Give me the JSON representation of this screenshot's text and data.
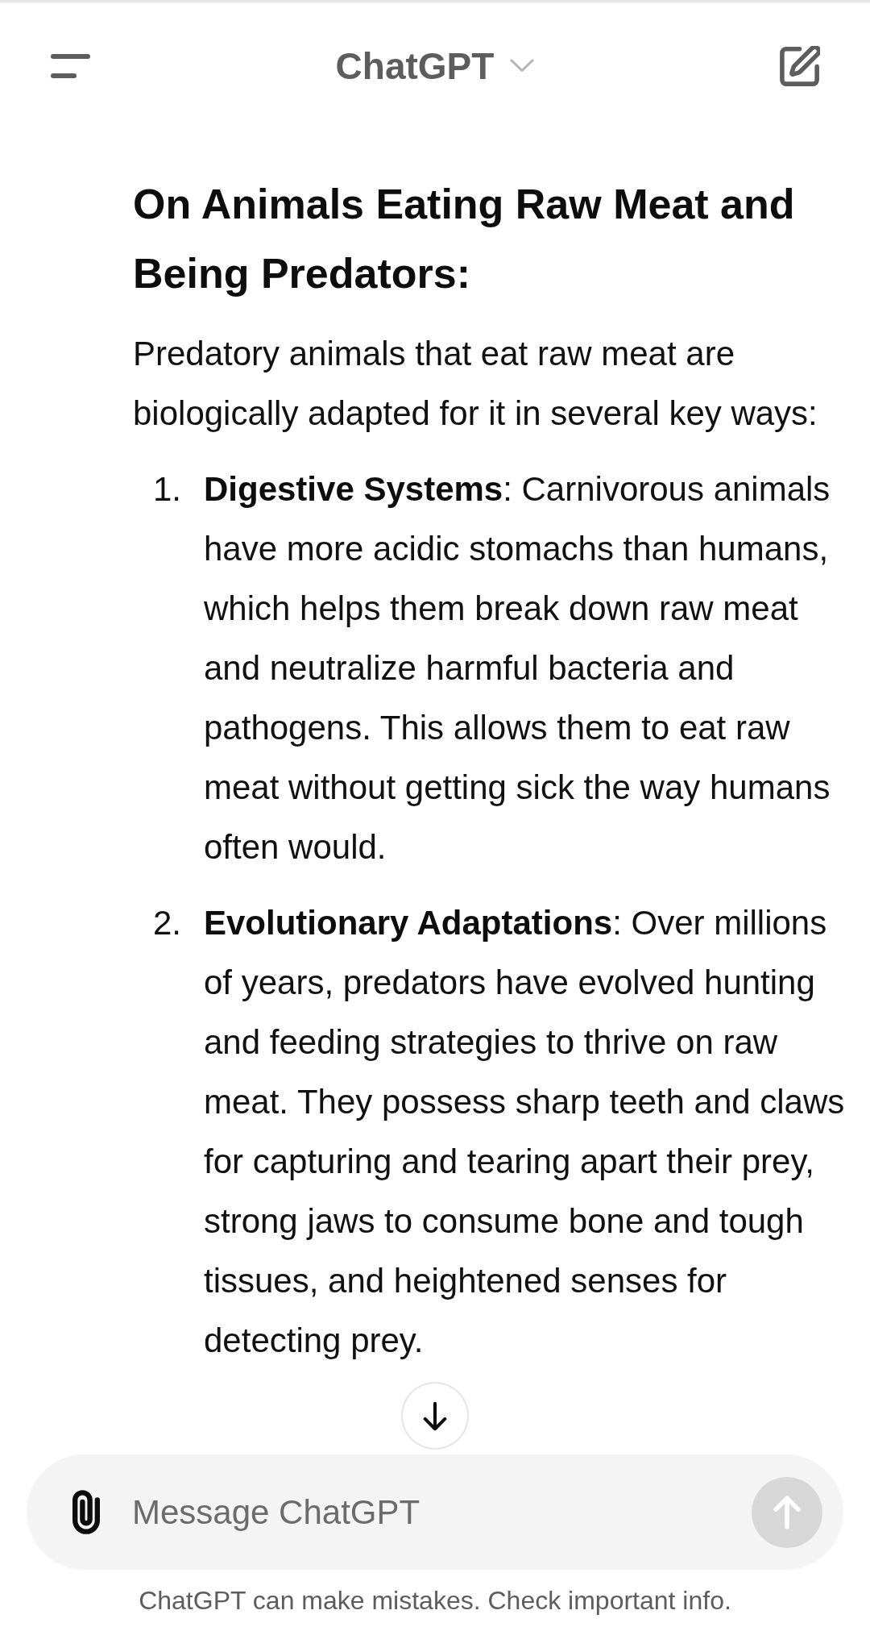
{
  "header": {
    "title": "ChatGPT"
  },
  "message": {
    "heading": "On Animals Eating Raw Meat and Being Predators:",
    "intro": "Predatory animals that eat raw meat are biologically adapted for it in several key ways:",
    "points": [
      {
        "number": "1.",
        "text": "**Digestive Systems**: Carnivorous animals have more acidic stomachs than humans, which helps them break down raw meat and neutralize harmful bacteria and pathogens. This allows them to eat raw meat without getting sick the way humans often would."
      },
      {
        "number": "2.",
        "text": "**Evolutionary Adaptations**: Over millions of years, predators have evolved hunting and feeding strategies to thrive on raw meat. They possess sharp teeth and claws for capturing and tearing apart their prey, strong jaws to consume bone and tough tissues, and heightened senses for detecting prey."
      }
    ]
  },
  "composer": {
    "placeholder": "Message ChatGPT",
    "send_button": {
      "disabled": true
    }
  },
  "disclaimer": "ChatGPT can make mistakes. Check important info."
}
